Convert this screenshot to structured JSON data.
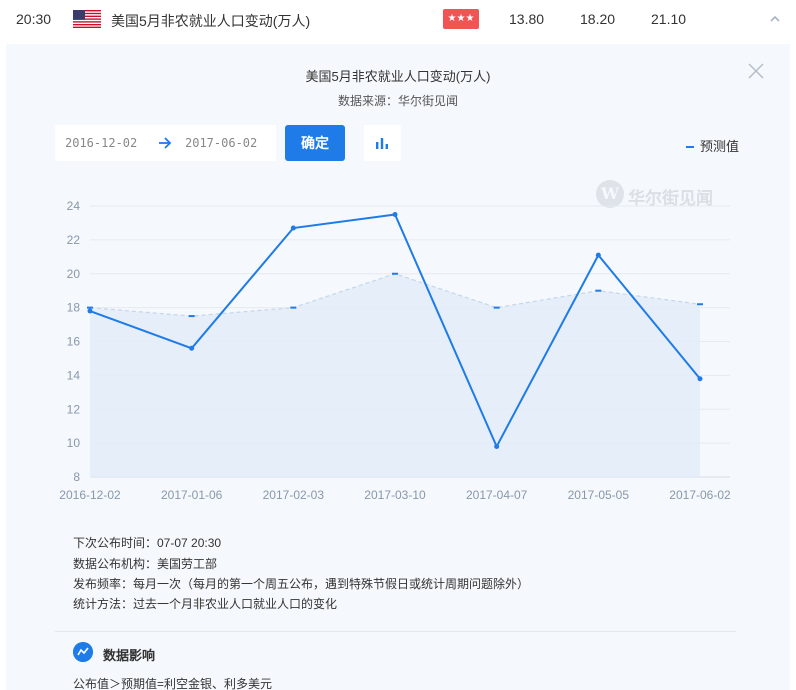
{
  "row": {
    "time": "20:30",
    "event": "美国5月非农就业人口变动(万人)",
    "importance_stars": "★★★",
    "previous": "13.80",
    "forecast": "18.20",
    "actual": "21.10",
    "importance_color": "#f25353"
  },
  "panel": {
    "title": "美国5月非农就业人口变动(万人)",
    "source": "数据来源：华尔街见闻",
    "date_from": "2016-12-02",
    "date_to": "2017-06-02",
    "confirm_label": "确定",
    "legend_label": "预测值",
    "watermark_text": "华尔街见闻",
    "watermark_mark": "W"
  },
  "chart_data": {
    "type": "line",
    "x": [
      "2016-12-02",
      "2017-01-06",
      "2017-02-03",
      "2017-03-10",
      "2017-04-07",
      "2017-05-05",
      "2017-06-02"
    ],
    "y_ticks": [
      8,
      10,
      12,
      14,
      16,
      18,
      20,
      22,
      24
    ],
    "ylim": [
      8,
      24
    ],
    "grid": true,
    "legend_position": "top-right",
    "series": [
      {
        "values": [
          17.8,
          15.6,
          22.7,
          23.5,
          9.8,
          21.1,
          13.8
        ],
        "color": "#1e7be8"
      },
      {
        "name": "预测值",
        "values": [
          18.0,
          17.5,
          18.0,
          20.0,
          18.0,
          19.0,
          18.2
        ],
        "color": "#1e7be8"
      }
    ]
  },
  "info": {
    "next_release": "下次公布时间：07-07 20:30",
    "agency": "数据公布机构：美国劳工部",
    "frequency": "发布频率：每月一次（每月的第一个周五公布，遇到特殊节假日或统计周期问题除外）",
    "method": "统计方法：过去一个月非农业人口就业人口的变化"
  },
  "impact": {
    "title": "数据影响",
    "text": "公布值＞预期值=利空金银、利多美元"
  },
  "colors": {
    "accent": "#1e7be8",
    "panel_bg": "#f5f8fc"
  }
}
